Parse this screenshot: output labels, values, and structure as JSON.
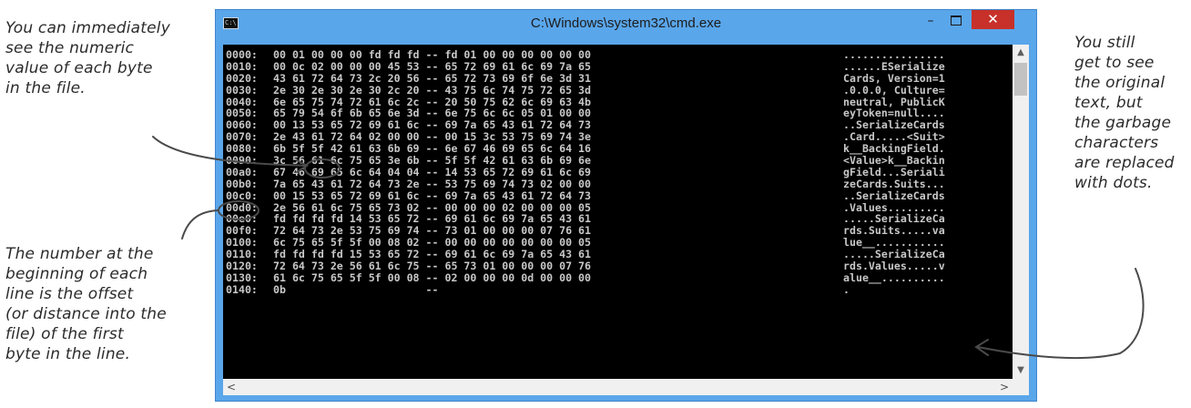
{
  "annotations": {
    "top_left": "You can immediately\nsee the numeric\nvalue of each byte\nin the file.",
    "bottom_left": "The number at the\nbeginning of each\nline is the offset\n(or distance into the\nfile) of the first\nbyte in the line.",
    "right": "You still\nget to see\nthe original\ntext, but\nthe garbage\ncharacters\nare replaced\nwith dots."
  },
  "window": {
    "title": "C:\\Windows\\system32\\cmd.exe",
    "icon": "cmd-icon",
    "minimize_label": "–",
    "close_label": "✕"
  },
  "hexdump": [
    {
      "offset": "0000:",
      "hex": "00 01 00 00 00 fd fd fd -- fd 01 00 00 00 00 00 00",
      "ascii": "................"
    },
    {
      "offset": "0010:",
      "hex": "00 0c 02 00 00 00 45 53 -- 65 72 69 61 6c 69 7a 65",
      "ascii": "......ESerialize"
    },
    {
      "offset": "0020:",
      "hex": "43 61 72 64 73 2c 20 56 -- 65 72 73 69 6f 6e 3d 31",
      "ascii": "Cards, Version=1"
    },
    {
      "offset": "0030:",
      "hex": "2e 30 2e 30 2e 30 2c 20 -- 43 75 6c 74 75 72 65 3d",
      "ascii": ".0.0.0, Culture="
    },
    {
      "offset": "0040:",
      "hex": "6e 65 75 74 72 61 6c 2c -- 20 50 75 62 6c 69 63 4b",
      "ascii": "neutral, PublicK"
    },
    {
      "offset": "0050:",
      "hex": "65 79 54 6f 6b 65 6e 3d -- 6e 75 6c 6c 05 01 00 00",
      "ascii": "eyToken=null...."
    },
    {
      "offset": "0060:",
      "hex": "00 13 53 65 72 69 61 6c -- 69 7a 65 43 61 72 64 73",
      "ascii": "..SerializeCards"
    },
    {
      "offset": "0070:",
      "hex": "2e 43 61 72 64 02 00 00 -- 00 15 3c 53 75 69 74 3e",
      "ascii": ".Card.....<Suit>"
    },
    {
      "offset": "0080:",
      "hex": "6b 5f 5f 42 61 63 6b 69 -- 6e 67 46 69 65 6c 64 16",
      "ascii": "k__BackingField."
    },
    {
      "offset": "0090:",
      "hex": "3c 56 61 6c 75 65 3e 6b -- 5f 5f 42 61 63 6b 69 6e",
      "ascii": "<Value>k__Backin"
    },
    {
      "offset": "00a0:",
      "hex": "67 46 69 65 6c 64 04 04 -- 14 53 65 72 69 61 6c 69",
      "ascii": "gField...Seriali"
    },
    {
      "offset": "00b0:",
      "hex": "7a 65 43 61 72 64 73 2e -- 53 75 69 74 73 02 00 00",
      "ascii": "zeCards.Suits..."
    },
    {
      "offset": "00c0:",
      "hex": "00 15 53 65 72 69 61 6c -- 69 7a 65 43 61 72 64 73",
      "ascii": "..SerializeCards"
    },
    {
      "offset": "00d0:",
      "hex": "2e 56 61 6c 75 65 73 02 -- 00 00 00 02 00 00 00 05",
      "ascii": ".Values........."
    },
    {
      "offset": "00e0:",
      "hex": "fd fd fd fd 14 53 65 72 -- 69 61 6c 69 7a 65 43 61",
      "ascii": ".....SerializeCa"
    },
    {
      "offset": "00f0:",
      "hex": "72 64 73 2e 53 75 69 74 -- 73 01 00 00 00 07 76 61",
      "ascii": "rds.Suits.....va"
    },
    {
      "offset": "0100:",
      "hex": "6c 75 65 5f 5f 00 08 02 -- 00 00 00 00 00 00 00 05",
      "ascii": "lue__..........."
    },
    {
      "offset": "0110:",
      "hex": "fd fd fd fd 15 53 65 72 -- 69 61 6c 69 7a 65 43 61",
      "ascii": ".....SerializeCa"
    },
    {
      "offset": "0120:",
      "hex": "72 64 73 2e 56 61 6c 75 -- 65 73 01 00 00 00 07 76",
      "ascii": "rds.Values.....v"
    },
    {
      "offset": "0130:",
      "hex": "61 6c 75 65 5f 5f 00 08 -- 02 00 00 00 0d 00 00 00",
      "ascii": "alue__.........."
    },
    {
      "offset": "0140:",
      "hex": "0b                      --",
      "ascii": "."
    }
  ],
  "scrollbars": {
    "up_icon": "scroll-up-arrow",
    "down_icon": "scroll-down-arrow",
    "left_icon": "scroll-left-arrow",
    "right_icon": "scroll-right-arrow"
  },
  "colors": {
    "titlebar": "#5aa6ea",
    "close_button": "#c7312a",
    "console_bg": "#000000",
    "console_text": "#c8c8c8"
  }
}
